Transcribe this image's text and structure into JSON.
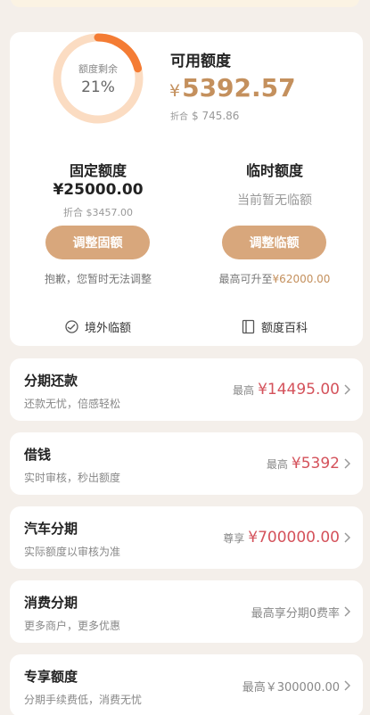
{
  "gauge": {
    "label": "额度剩余",
    "value": "21%",
    "percent": 21
  },
  "available": {
    "title": "可用额度",
    "currency": "¥",
    "amount": "5392.57",
    "usd_prefix": "折合",
    "usd": "$ 745.86"
  },
  "fixed": {
    "title": "固定额度",
    "amount": "¥25000.00",
    "usd": "折合 $3457.00",
    "button": "调整固额",
    "note": "抱歉，您暂时无法调整"
  },
  "temp": {
    "title": "临时额度",
    "note_top": "当前暂无临额",
    "button": "调整临额",
    "note_prefix": "最高可升至",
    "note_value": "¥62000.00"
  },
  "links": {
    "overseas": "境外临额",
    "encyclopedia": "额度百科"
  },
  "rows": [
    {
      "title": "分期还款",
      "sub": "还款无忧，倍感轻松",
      "prefix": "最高",
      "value": "¥14495.00"
    },
    {
      "title": "借钱",
      "sub": "实时审核，秒出额度",
      "prefix": "最高",
      "value": "¥5392"
    },
    {
      "title": "汽车分期",
      "sub": "实际额度以审核为准",
      "prefix": "尊享",
      "value": "¥700000.00"
    },
    {
      "title": "消费分期",
      "sub": "更多商户，更多优惠",
      "prefix": "",
      "value": "最高享分期0费率"
    },
    {
      "title": "专享额度",
      "sub": "分期手续费低，消费无忧",
      "prefix": "",
      "value": "最高￥300000.00"
    }
  ],
  "colors": {
    "accent": "#c4905d",
    "button": "#d8a77c",
    "red": "#d4525b",
    "gauge_track": "#fbdcc2",
    "gauge_fill": "#f47c34"
  }
}
